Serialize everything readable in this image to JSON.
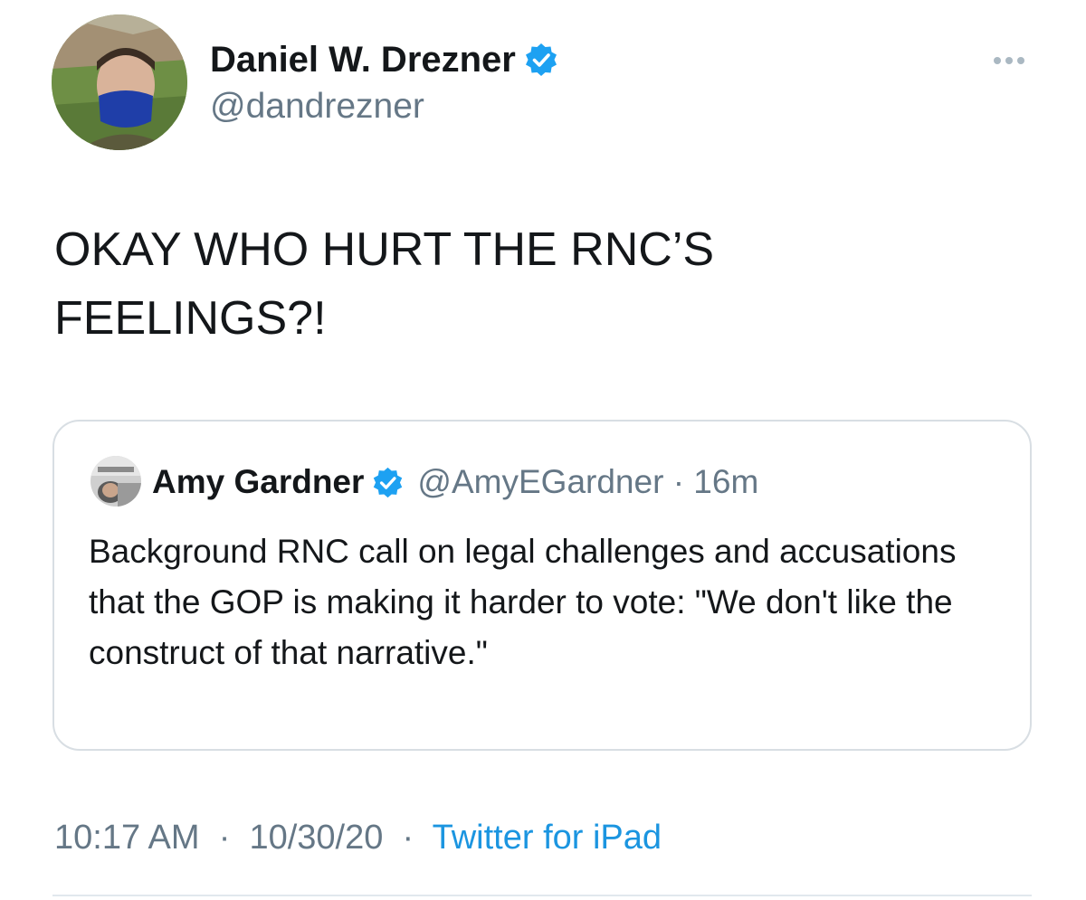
{
  "tweet": {
    "author": {
      "name": "Daniel W. Drezner",
      "handle": "@dandrezner",
      "verified": true
    },
    "text": "OKAY WHO HURT THE RNC’S\nFEELINGS?!",
    "quoted_tweet": {
      "name": "Amy Gardner",
      "handle": "@AmyEGardner",
      "separator": "·",
      "age": "16m",
      "verified": true,
      "text": "Background RNC call on legal challenges and accusations that the GOP is making it harder to vote: \"We don't like the construct of that narrative.\""
    },
    "time": "10:17 AM",
    "date": "10/30/20",
    "separator": "·",
    "source": "Twitter for iPad"
  },
  "icons": {
    "verified": "verified-badge-icon",
    "more": "more-dots-icon"
  },
  "colors": {
    "primary_text": "#14171a",
    "secondary_text": "#657786",
    "link": "#1b95e0",
    "verified_badge": "#1da1f2",
    "border": "#d8dee3"
  }
}
